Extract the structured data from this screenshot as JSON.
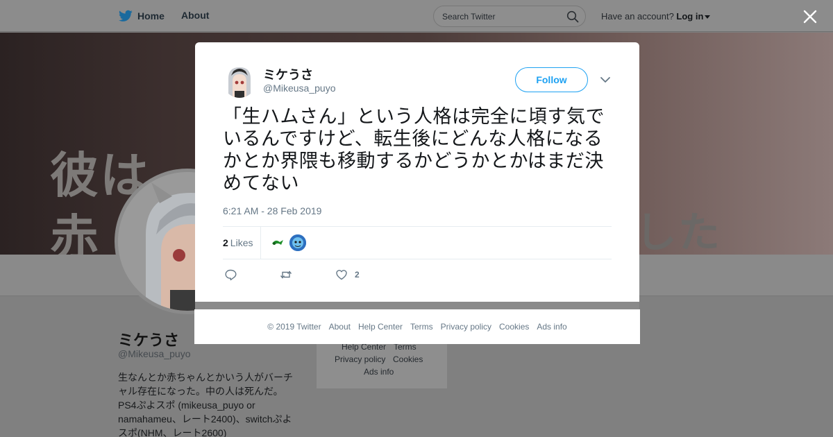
{
  "topbar": {
    "home_label": "Home",
    "about_label": "About",
    "search_placeholder": "Search Twitter",
    "account_prompt": "Have an account?",
    "login_label": "Log in"
  },
  "banner": {
    "line1": "彼は",
    "line2": "赤",
    "line3": "した"
  },
  "profile": {
    "name": "ミケうさ",
    "handle": "@Mikeusa_puyo",
    "bio": "生なんとか赤ちゃんとかいう人がバーチャル存在になった。中の人は死んだ。PS4ぷよスポ (mikeusa_puyo or namahameu、レート2400)、switchぷよスポ(NHM、レート2600)"
  },
  "side_links": {
    "help_center": "Help Center",
    "terms": "Terms",
    "privacy": "Privacy policy",
    "cookies": "Cookies",
    "ads": "Ads info"
  },
  "tweet": {
    "author_name": "ミケうさ",
    "author_handle": "@Mikeusa_puyo",
    "follow_label": "Follow",
    "text": "「生ハムさん」という人格は完全に頃す気でいるんですけど、転生後にどんな人格になるかとか界隈も移動するかどうかとかはまだ決めてない",
    "timestamp": "6:21 AM - 28 Feb 2019",
    "likes_count": "2",
    "likes_label": "Likes",
    "like_action_count": "2"
  },
  "footer": {
    "copyright": "© 2019 Twitter",
    "about": "About",
    "help_center": "Help Center",
    "terms": "Terms",
    "privacy": "Privacy policy",
    "cookies": "Cookies",
    "ads": "Ads info"
  },
  "colors": {
    "accent": "#1da1f2",
    "overlay": "#808080",
    "muted_text": "#657786"
  },
  "icons": [
    "twitter-bird-icon",
    "search-icon",
    "close-icon",
    "chevron-down-icon",
    "reply-icon",
    "retweet-icon",
    "heart-icon"
  ]
}
